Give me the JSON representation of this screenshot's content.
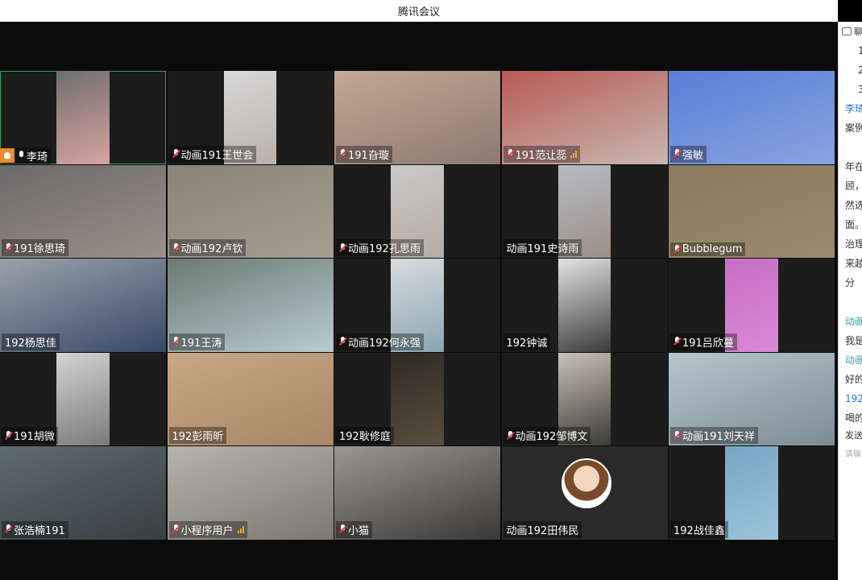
{
  "window": {
    "title": "腾讯会议"
  },
  "participants": [
    {
      "name": "李琦",
      "host": true,
      "mic": "on",
      "signal": false,
      "active": true,
      "bg": "#6e6e6e",
      "video": "center",
      "tone": "#d9a4a0"
    },
    {
      "name": "动画191王世会",
      "host": false,
      "mic": "muted",
      "signal": false,
      "active": false,
      "bg": "#d8d8d8",
      "video": "center",
      "tone": "#b8b2ad"
    },
    {
      "name": "191旮璇",
      "host": false,
      "mic": "muted",
      "signal": false,
      "active": false,
      "bg": "#c4a896",
      "video": "full",
      "tone": "#8c7a70"
    },
    {
      "name": "191范让蕊",
      "host": false,
      "mic": "muted",
      "signal": true,
      "active": false,
      "bg": "#b85a55",
      "video": "full",
      "tone": "#c9b7b0"
    },
    {
      "name": "强敏",
      "host": false,
      "mic": "muted",
      "signal": false,
      "active": false,
      "bg": "#5a7fd8",
      "video": "full",
      "tone": "#8aa3e0"
    },
    {
      "name": "191徐思琦",
      "host": false,
      "mic": "muted",
      "signal": false,
      "active": false,
      "bg": "#6a6a6a",
      "video": "full",
      "tone": "#9c9088"
    },
    {
      "name": "动画192卢钦",
      "host": false,
      "mic": "muted",
      "signal": false,
      "active": false,
      "bg": "#8a8478",
      "video": "full",
      "tone": "#a59f93"
    },
    {
      "name": "动画192孔思雨",
      "host": false,
      "mic": "muted",
      "signal": false,
      "active": false,
      "bg": "#c9c9c9",
      "video": "center",
      "tone": "#b5aca6"
    },
    {
      "name": "动画191史诗雨",
      "host": false,
      "mic": "none",
      "signal": false,
      "active": false,
      "bg": "#b7bcc4",
      "video": "center",
      "tone": "#9c8e86"
    },
    {
      "name": "Bubblegum",
      "host": false,
      "mic": "muted",
      "signal": false,
      "active": false,
      "bg": "#8a7a5c",
      "video": "full",
      "tone": "#9b8b6d"
    },
    {
      "name": "192杨思佳",
      "host": false,
      "mic": "none",
      "signal": false,
      "active": false,
      "bg": "#9aa3ac",
      "video": "full",
      "tone": "#384866"
    },
    {
      "name": "191王涛",
      "host": false,
      "mic": "muted",
      "signal": false,
      "active": false,
      "bg": "#6b7a72",
      "video": "full",
      "tone": "#b8ccd2"
    },
    {
      "name": "动画192何永强",
      "host": false,
      "mic": "muted",
      "signal": false,
      "active": false,
      "bg": "#d9dce0",
      "video": "center",
      "tone": "#8aa6b2"
    },
    {
      "name": "192钟诚",
      "host": false,
      "mic": "none",
      "signal": false,
      "active": false,
      "bg": "#e4e4e4",
      "video": "center",
      "tone": "#3a3a3a"
    },
    {
      "name": "191吕欣蔓",
      "host": false,
      "mic": "muted",
      "signal": false,
      "active": false,
      "bg": "#c86ec6",
      "video": "center",
      "tone": "#d88ad6"
    },
    {
      "name": "191胡微",
      "host": false,
      "mic": "muted",
      "signal": false,
      "active": false,
      "bg": "#d4d4d4",
      "video": "center",
      "tone": "#7a7a7a"
    },
    {
      "name": "192彭雨昕",
      "host": false,
      "mic": "none",
      "signal": false,
      "active": false,
      "bg": "#caa886",
      "video": "full",
      "tone": "#a88666"
    },
    {
      "name": "192耿修庭",
      "host": false,
      "mic": "none",
      "signal": false,
      "active": false,
      "bg": "#2c2a24",
      "video": "center",
      "tone": "#5a4e3e"
    },
    {
      "name": "动画192邹博文",
      "host": false,
      "mic": "muted",
      "signal": false,
      "active": false,
      "bg": "#c9c3b8",
      "video": "center",
      "tone": "#3c3a36"
    },
    {
      "name": "动画191刘天祥",
      "host": false,
      "mic": "muted",
      "signal": false,
      "active": false,
      "bg": "#b8c6ce",
      "video": "full",
      "tone": "#7d8d94"
    },
    {
      "name": "张浩楠191",
      "host": false,
      "mic": "muted",
      "signal": false,
      "active": false,
      "bg": "#5e6b70",
      "video": "full",
      "tone": "#383e40"
    },
    {
      "name": "小程序用户",
      "host": false,
      "mic": "muted",
      "signal": true,
      "active": false,
      "bg": "#b7b3ad",
      "video": "full",
      "tone": "#7c7872"
    },
    {
      "name": "小猫",
      "host": false,
      "mic": "muted",
      "signal": false,
      "active": false,
      "bg": "#9a9795",
      "video": "full",
      "tone": "#3a3836"
    },
    {
      "name": "动画192田伟民",
      "host": false,
      "mic": "none",
      "signal": false,
      "active": false,
      "bg": "#2a2a2a",
      "video": "avatar",
      "tone": "#2a2a2a"
    },
    {
      "name": "192战佳鑫",
      "host": false,
      "mic": "none",
      "signal": false,
      "active": false,
      "bg": "#77a6c4",
      "video": "center",
      "tone": "#9cc3dc"
    }
  ],
  "chat": {
    "header": "聊",
    "lines": [
      {
        "text": "1",
        "style": "num"
      },
      {
        "text": "2",
        "style": "num"
      },
      {
        "text": "3",
        "style": "num"
      },
      {
        "text": "李琦",
        "style": "blue"
      },
      {
        "text": "案例",
        "style": ""
      },
      {
        "text": "",
        "style": ""
      },
      {
        "text": "年在",
        "style": ""
      },
      {
        "text": "顾，",
        "style": ""
      },
      {
        "text": "然选",
        "style": ""
      },
      {
        "text": "面。",
        "style": ""
      },
      {
        "text": "治理",
        "style": ""
      },
      {
        "text": "来越",
        "style": ""
      },
      {
        "text": "分",
        "style": ""
      },
      {
        "text": "",
        "style": ""
      },
      {
        "text": "动画",
        "style": "teal"
      },
      {
        "text": "我是",
        "style": ""
      },
      {
        "text": "动画",
        "style": "teal"
      },
      {
        "text": "好的",
        "style": ""
      },
      {
        "text": "192",
        "style": "blue"
      },
      {
        "text": "喝的",
        "style": ""
      }
    ],
    "send_label": "发送",
    "input_hint": "请输"
  }
}
